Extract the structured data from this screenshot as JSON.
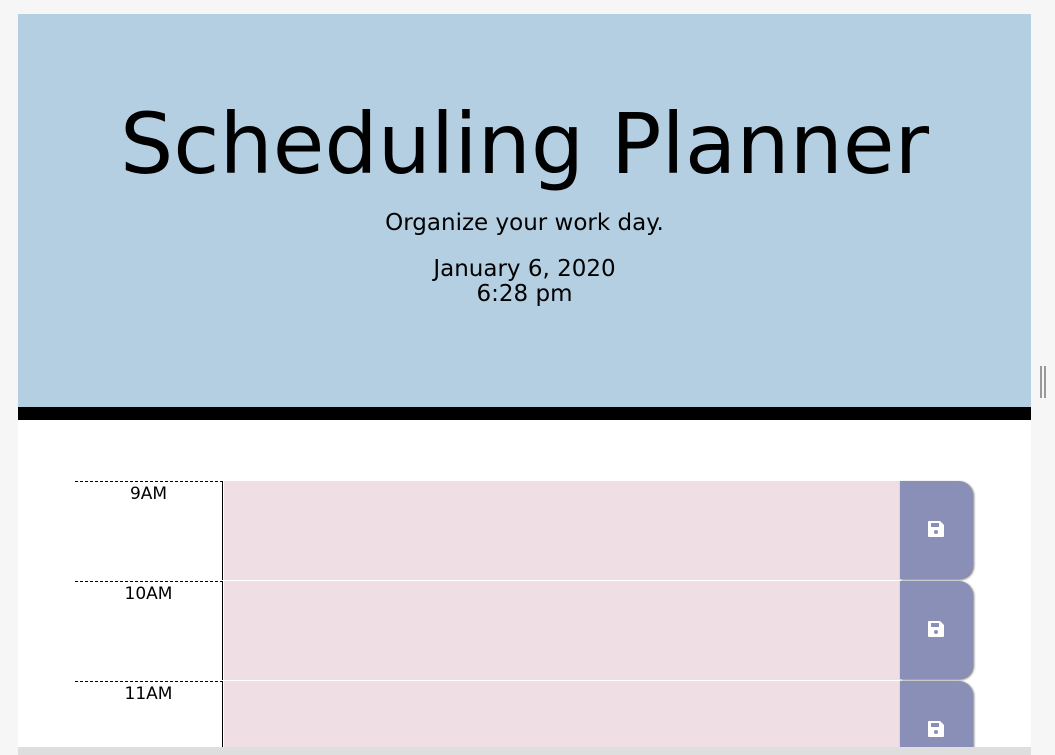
{
  "header": {
    "title": "Scheduling Planner",
    "lead": "Organize your work day.",
    "date": "January 6, 2020",
    "time": "6:28 pm",
    "background_color": "#b5cfe2",
    "border_color": "#000000"
  },
  "timeblocks": [
    {
      "hour": "9AM",
      "description": "",
      "save_icon": "floppy-disk-icon"
    },
    {
      "hour": "10AM",
      "description": "",
      "save_icon": "floppy-disk-icon"
    },
    {
      "hour": "11AM",
      "description": "",
      "save_icon": "floppy-disk-icon"
    }
  ],
  "colors": {
    "future_block": "#efdee4",
    "save_button": "#8a8fb8"
  }
}
